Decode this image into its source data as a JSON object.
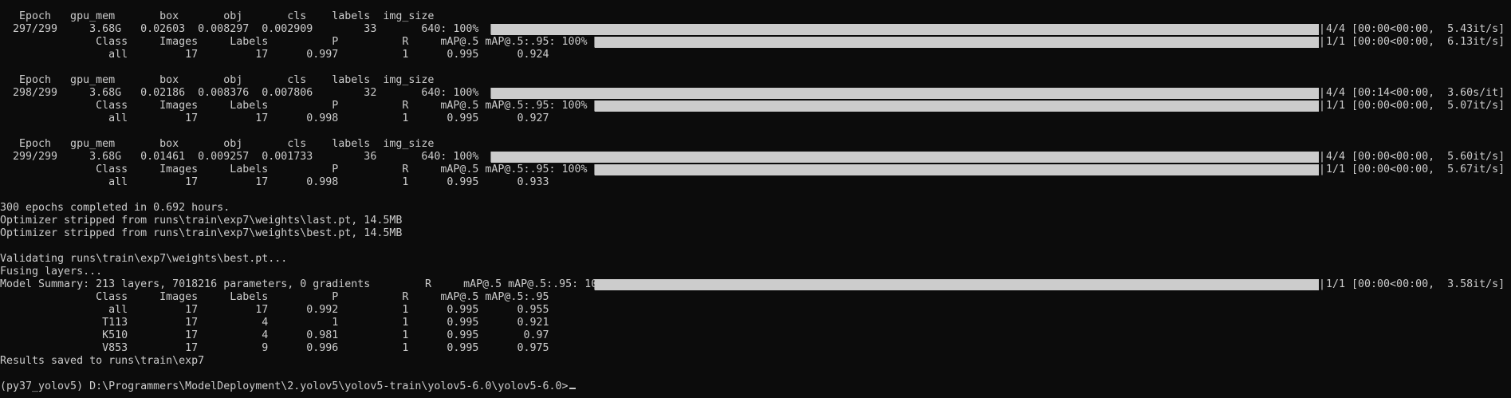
{
  "epochs": [
    {
      "header": "   Epoch   gpu_mem       box       obj       cls    labels  img_size",
      "train": "  297/299     3.68G   0.02603  0.008297  0.002909        33       640: 100%",
      "train_rate": "4/4 [00:00<00:00,  5.43it/s]",
      "val_header": "               Class     Images     Labels          P          R     mAP@.5 mAP@.5:.95: 100%",
      "val_rate": "1/1 [00:00<00:00,  6.13it/s]",
      "val_all": "                 all         17         17      0.997          1      0.995      0.924"
    },
    {
      "header": "   Epoch   gpu_mem       box       obj       cls    labels  img_size",
      "train": "  298/299     3.68G   0.02186  0.008376  0.007806        32       640: 100%",
      "train_rate": "4/4 [00:14<00:00,  3.60s/it]",
      "val_header": "               Class     Images     Labels          P          R     mAP@.5 mAP@.5:.95: 100%",
      "val_rate": "1/1 [00:00<00:00,  5.07it/s]",
      "val_all": "                 all         17         17      0.998          1      0.995      0.927"
    },
    {
      "header": "   Epoch   gpu_mem       box       obj       cls    labels  img_size",
      "train": "  299/299     3.68G   0.01461  0.009257  0.001733        36       640: 100%",
      "train_rate": "4/4 [00:00<00:00,  5.60it/s]",
      "val_header": "               Class     Images     Labels          P          R     mAP@.5 mAP@.5:.95: 100%",
      "val_rate": "1/1 [00:00<00:00,  5.67it/s]",
      "val_all": "                 all         17         17      0.998          1      0.995      0.933"
    }
  ],
  "summary": {
    "completed": "300 epochs completed in 0.692 hours.",
    "stripped_last": "Optimizer stripped from runs\\train\\exp7\\weights\\last.pt, 14.5MB",
    "stripped_best": "Optimizer stripped from runs\\train\\exp7\\weights\\best.pt, 14.5MB",
    "validating": "Validating runs\\train\\exp7\\weights\\best.pt...",
    "fusing": "Fusing layers...",
    "model_summary_prefix": "Model Summary: 213 layers, 7018216 parameters, 0 gradients",
    "model_summary_header": "          R     mAP@.5 mAP@.5:.95: 100%",
    "final_rate": "1/1 [00:00<00:00,  3.58it/s]",
    "class_header": "               Class     Images     Labels          P          R     mAP@.5 mAP@.5:.95",
    "rows": [
      "                 all         17         17      0.992          1      0.995      0.955",
      "                T113         17          4          1          1      0.995      0.921",
      "                K510         17          4      0.981          1      0.995       0.97",
      "                V853         17          9      0.996          1      0.995      0.975"
    ],
    "results_saved": "Results saved to runs\\train\\exp7"
  },
  "prompt": {
    "text": "(py37_yolov5) D:\\Programmers\\ModelDeployment\\2.yolov5\\yolov5-train\\yolov5-6.0\\yolov5-6.0>"
  },
  "progress": {
    "train_fraction": 1.0,
    "val_fraction": 1.0
  },
  "colors": {
    "background": "#0c0c0c",
    "foreground": "#cccccc",
    "bar": "#cccccc"
  }
}
